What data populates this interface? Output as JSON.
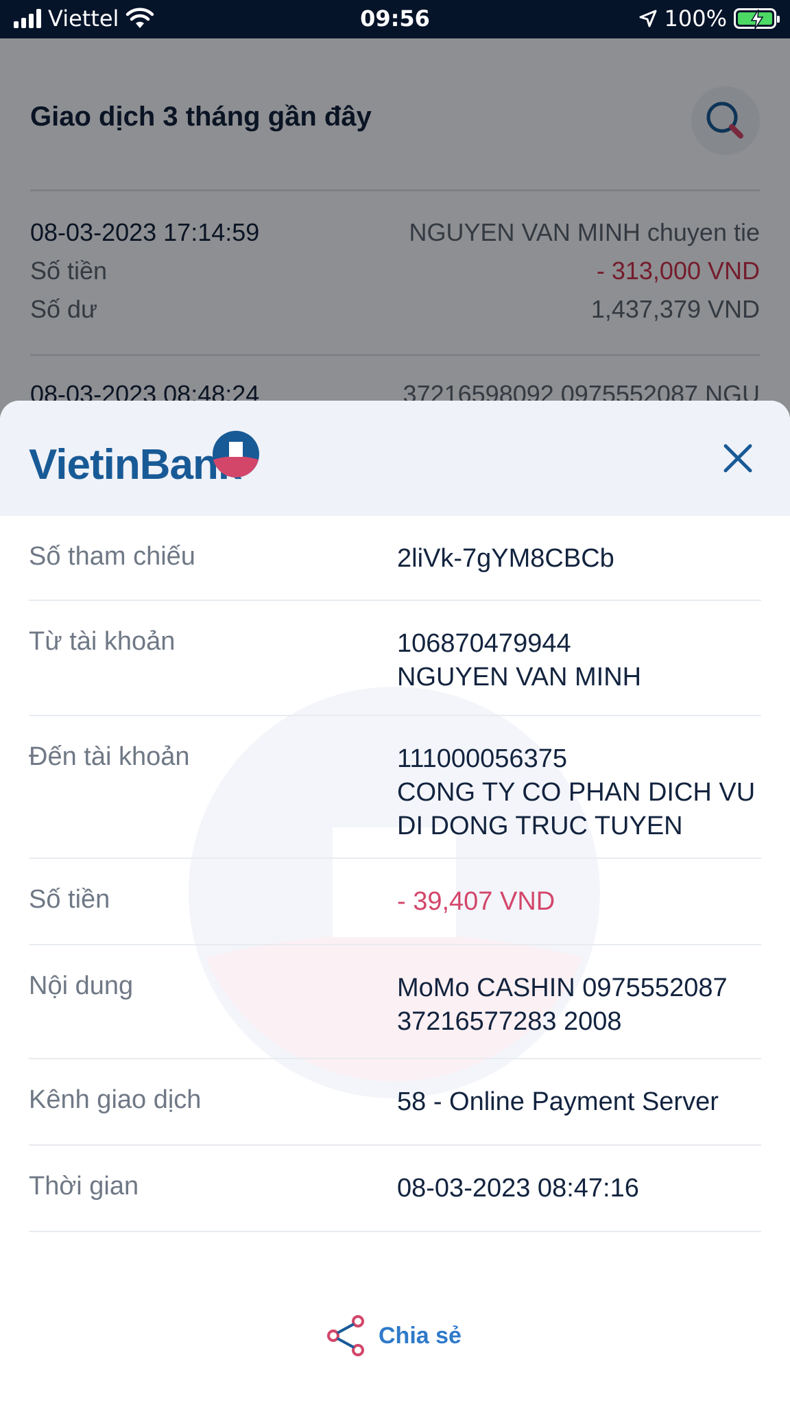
{
  "status_bar": {
    "carrier": "Viettel",
    "time": "09:56",
    "battery": "100%"
  },
  "background": {
    "title": "Giao dịch 3 tháng gần đây",
    "transactions": [
      {
        "datetime": "08-03-2023 17:14:59",
        "description": "NGUYEN VAN MINH chuyen tie",
        "amount_label": "Số tiền",
        "amount": "- 313,000 VND",
        "balance_label": "Số dư",
        "balance": "1,437,379 VND"
      },
      {
        "datetime": "08-03-2023 08:48:24",
        "description": "37216598092 0975552087 NGU"
      }
    ]
  },
  "sheet": {
    "brand": "VietinBank",
    "details": [
      {
        "label": "Số tham chiếu",
        "lines": [
          "2liVk-7gYM8CBCb"
        ]
      },
      {
        "label": "Từ tài khoản",
        "lines": [
          "106870479944",
          "NGUYEN VAN MINH"
        ]
      },
      {
        "label": "Đến tài khoản",
        "lines": [
          "111000056375",
          "CONG TY CO PHAN DICH VU",
          "DI DONG TRUC TUYEN"
        ]
      },
      {
        "label": "Số tiền",
        "lines": [
          "- 39,407 VND"
        ]
      },
      {
        "label": "Nội dung",
        "lines": [
          "MoMo CASHIN 0975552087",
          "37216577283 2008"
        ]
      },
      {
        "label": "Kênh giao dịch",
        "lines": [
          "58 - Online Payment Server"
        ]
      },
      {
        "label": "Thời gian",
        "lines": [
          "08-03-2023 08:47:16"
        ]
      }
    ],
    "share_label": "Chia sẻ"
  },
  "colors": {
    "brand_blue": "#185a96",
    "brand_red": "#d3466a",
    "share_blue": "#2f7ac9"
  },
  "icons": [
    "signal-icon",
    "wifi-icon",
    "location-arrow-icon",
    "battery-charging-icon",
    "search-icon",
    "close-icon",
    "share-icon"
  ]
}
